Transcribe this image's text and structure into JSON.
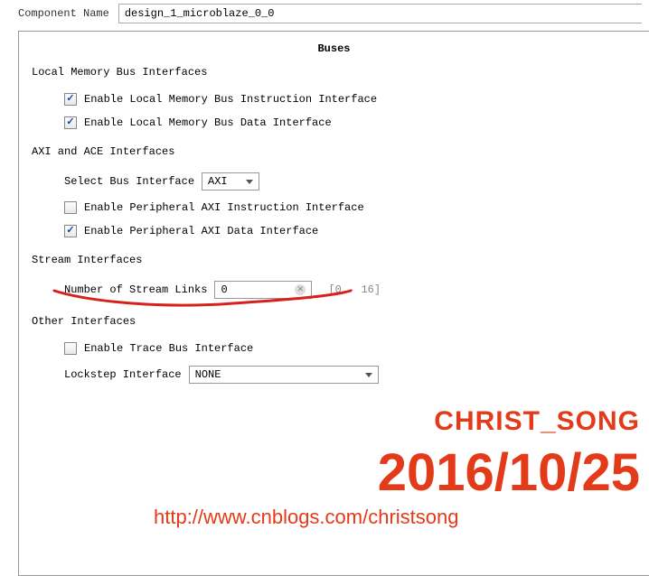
{
  "header": {
    "component_name_label": "Component Name",
    "component_name_value": "design_1_microblaze_0_0"
  },
  "panel": {
    "title": "Buses",
    "local_mem": {
      "section_label": "Local Memory Bus Interfaces",
      "enable_instr": {
        "label": "Enable Local Memory Bus Instruction Interface",
        "checked": true
      },
      "enable_data": {
        "label": "Enable Local Memory Bus Data Interface",
        "checked": true
      }
    },
    "axi": {
      "section_label": "AXI and ACE Interfaces",
      "select_bus_label": "Select Bus Interface",
      "select_bus_value": "AXI",
      "periph_instr": {
        "label": "Enable Peripheral AXI Instruction Interface",
        "checked": false
      },
      "periph_data": {
        "label": "Enable Peripheral AXI Data Interface",
        "checked": true
      }
    },
    "stream": {
      "section_label": "Stream Interfaces",
      "num_links_label": "Number of Stream Links",
      "num_links_value": "0",
      "range_hint": "[0 - 16]"
    },
    "other": {
      "section_label": "Other Interfaces",
      "trace": {
        "label": "Enable Trace Bus Interface",
        "checked": false
      },
      "lockstep_label": "Lockstep Interface",
      "lockstep_value": "NONE"
    }
  },
  "watermark": {
    "name": "CHRIST_SONG",
    "date": "2016/10/25",
    "url": "http://www.cnblogs.com/christsong"
  }
}
